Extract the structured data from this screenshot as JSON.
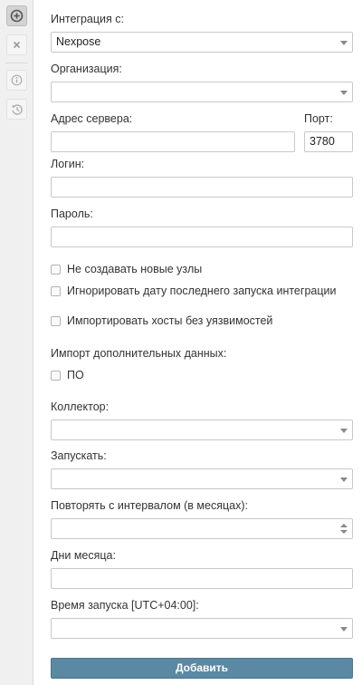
{
  "toolbar": {
    "items": [
      {
        "icon": "plus-circle-icon"
      },
      {
        "icon": "close-icon"
      },
      {
        "icon": "info-icon"
      },
      {
        "icon": "history-icon"
      }
    ]
  },
  "form": {
    "integration": {
      "label": "Интеграция с:",
      "value": "Nexpose"
    },
    "organization": {
      "label": "Организация:",
      "value": ""
    },
    "server_address": {
      "label": "Адрес сервера:",
      "value": ""
    },
    "port": {
      "label": "Порт:",
      "value": "3780"
    },
    "login": {
      "label": "Логин:",
      "value": ""
    },
    "password": {
      "label": "Пароль:",
      "value": ""
    },
    "checkboxes": [
      {
        "label": "Не создавать новые узлы",
        "checked": false
      },
      {
        "label": "Игнорировать дату последнего запуска интеграции",
        "checked": false
      },
      {
        "label": "Импортировать хосты без уязвимостей",
        "checked": false
      }
    ],
    "extra_import": {
      "label": "Импорт дополнительных данных:",
      "option_label": "ПО",
      "checked": false
    },
    "collector": {
      "label": "Коллектор:",
      "value": ""
    },
    "run": {
      "label": "Запускать:",
      "value": ""
    },
    "repeat_interval": {
      "label": "Повторять с интервалом (в месяцах):",
      "value": ""
    },
    "days_of_month": {
      "label": "Дни месяца:",
      "value": ""
    },
    "start_time": {
      "label": "Время запуска [UTC+04:00]:",
      "value": ""
    },
    "submit_label": "Добавить"
  }
}
